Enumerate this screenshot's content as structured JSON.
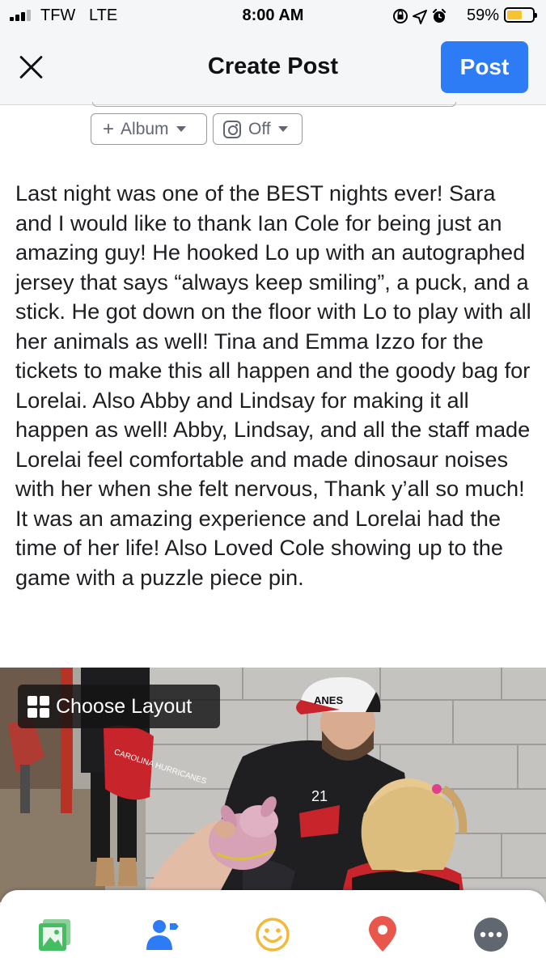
{
  "status_bar": {
    "carrier": "TFW",
    "network": "LTE",
    "time": "8:00 AM",
    "battery_percent": "59%",
    "battery_level": 0.59,
    "battery_color": "#f7c42f",
    "icons": [
      "screen-rotation-lock-icon",
      "location-arrow-icon",
      "alarm-icon"
    ]
  },
  "header": {
    "title": "Create Post",
    "close_icon": "close-icon",
    "post_label": "Post",
    "post_color": "#2d7cf6"
  },
  "audience": {
    "album_label": "Album",
    "instagram_label": "Off"
  },
  "post": {
    "text": "Last night was one of the BEST nights ever! Sara and I would like to thank Ian Cole for being just an amazing guy! He hooked Lo up with an autographed jersey that says “always keep smiling”, a puck, and a stick. He got down on the floor with Lo to play with all her animals as well! Tina and Emma Izzo for the tickets to make this all happen and the goody bag for Lorelai. Also Abby and Lindsay for making it all happen as well! Abby, Lindsay, and all the staff made Lorelai feel comfortable and made dinosaur noises with her when she felt nervous, Thank y’all so much! It was an amazing experience and Lorelai had the time of her life! Also Loved Cole showing up to the game with a puzzle piece pin."
  },
  "photo": {
    "layout_button_label": "Choose Layout",
    "cap_text": "ANES",
    "bag_text": "CAROLINA HURRICANES",
    "jersey_number": "21"
  },
  "bottom_tray": {
    "items": [
      "photo-icon",
      "tag-people-icon",
      "feeling-icon",
      "check-in-icon",
      "more-icon"
    ]
  }
}
